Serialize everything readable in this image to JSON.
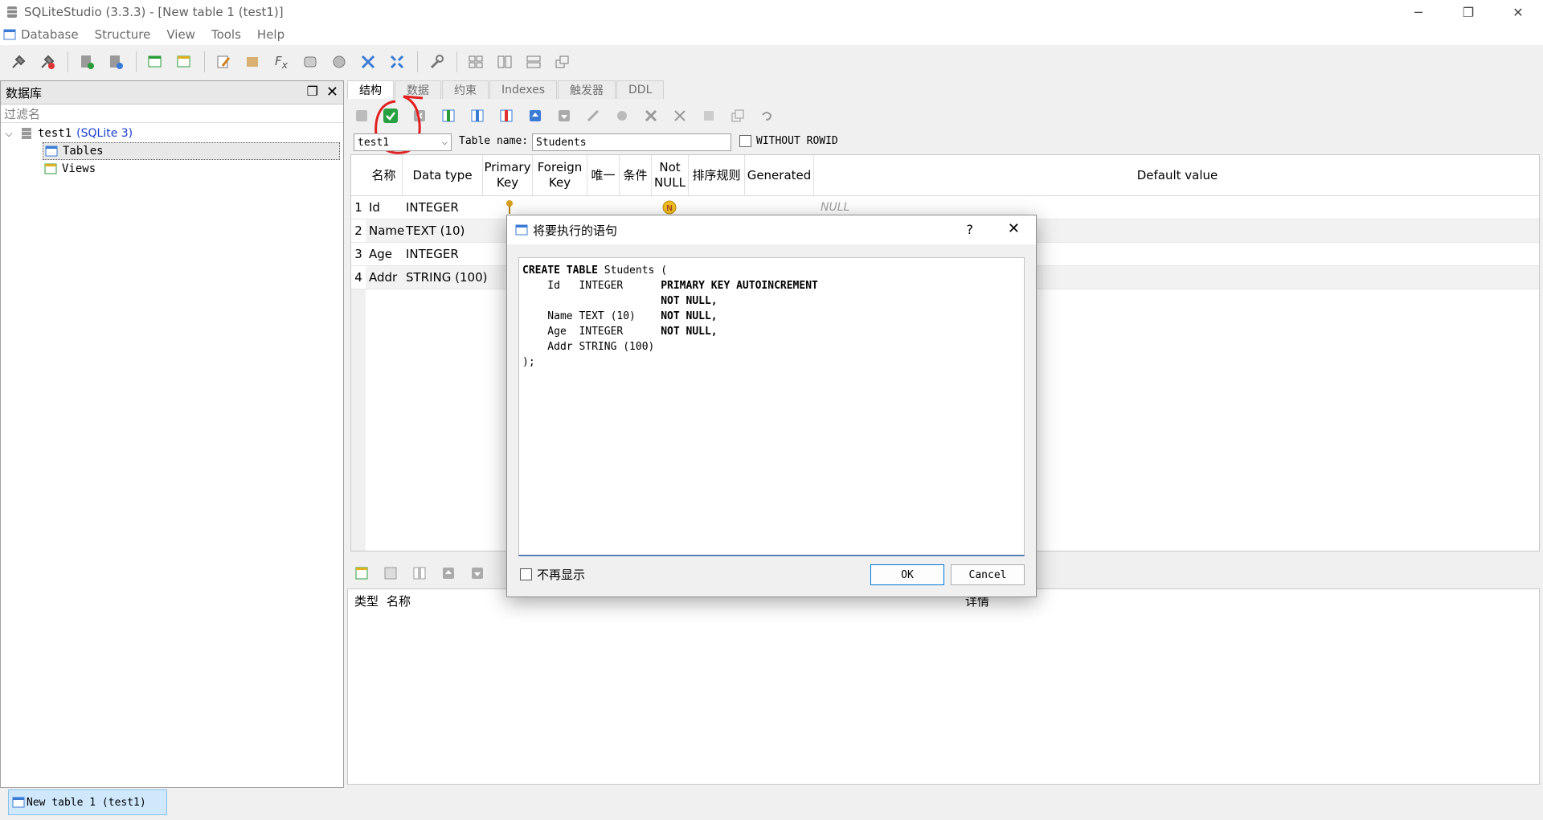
{
  "window": {
    "title": "SQLiteStudio (3.3.3) - [New table 1 (test1)]",
    "controls": [
      "─",
      "❐",
      "✕"
    ]
  },
  "menu": [
    "Database",
    "Structure",
    "View",
    "Tools",
    "Help"
  ],
  "left_panel": {
    "title": "数据库",
    "filter_placeholder": "过滤名",
    "db_name": "test1",
    "db_type": "(SQLite 3)",
    "tables_label": "Tables",
    "views_label": "Views"
  },
  "tabs": [
    "结构",
    "数据",
    "约束",
    "Indexes",
    "触发器",
    "DDL"
  ],
  "table_form": {
    "db_selected": "test1",
    "table_name_label": "Table name:",
    "table_name": "Students",
    "without_rowid_label": "WITHOUT ROWID"
  },
  "columns_header": [
    "名称",
    "Data type",
    "Primary Key",
    "Foreign Key",
    "唯一",
    "条件",
    "Not NULL",
    "排序规则",
    "Generated",
    "Default value"
  ],
  "rows": [
    {
      "num": "1",
      "name": "Id",
      "type": "INTEGER",
      "default": "NULL"
    },
    {
      "num": "2",
      "name": "Name",
      "type": "TEXT (10)",
      "default": ""
    },
    {
      "num": "3",
      "name": "Age",
      "type": "INTEGER",
      "default": ""
    },
    {
      "num": "4",
      "name": "Addr",
      "type": "STRING (100)",
      "default": ""
    }
  ],
  "bottom_header": {
    "type": "类型",
    "name": "名称",
    "details": "详情"
  },
  "status": {
    "window_button": "New table 1 (test1)"
  },
  "dialog": {
    "title": "将要执行的语句",
    "help": "?",
    "close": "✕",
    "sql_lines": [
      {
        "pre": "CREATE TABLE",
        "mid": " Students (",
        "post": ""
      },
      {
        "pre": "",
        "mid": "    Id   INTEGER      ",
        "post": "PRIMARY KEY AUTOINCREMENT"
      },
      {
        "pre": "",
        "mid": "                      ",
        "post": "NOT NULL,"
      },
      {
        "pre": "",
        "mid": "    Name TEXT (10)    ",
        "post": "NOT NULL,"
      },
      {
        "pre": "",
        "mid": "    Age  INTEGER      ",
        "post": "NOT NULL,"
      },
      {
        "pre": "",
        "mid": "    Addr STRING (100)",
        "post": ""
      },
      {
        "pre": "",
        "mid": ");",
        "post": ""
      }
    ],
    "dont_show_label": "不再显示",
    "ok_label": "OK",
    "cancel_label": "Cancel"
  },
  "colors": {
    "annotation": "#e02020",
    "accent": "#0078d7",
    "selection": "#cfe8fc"
  }
}
